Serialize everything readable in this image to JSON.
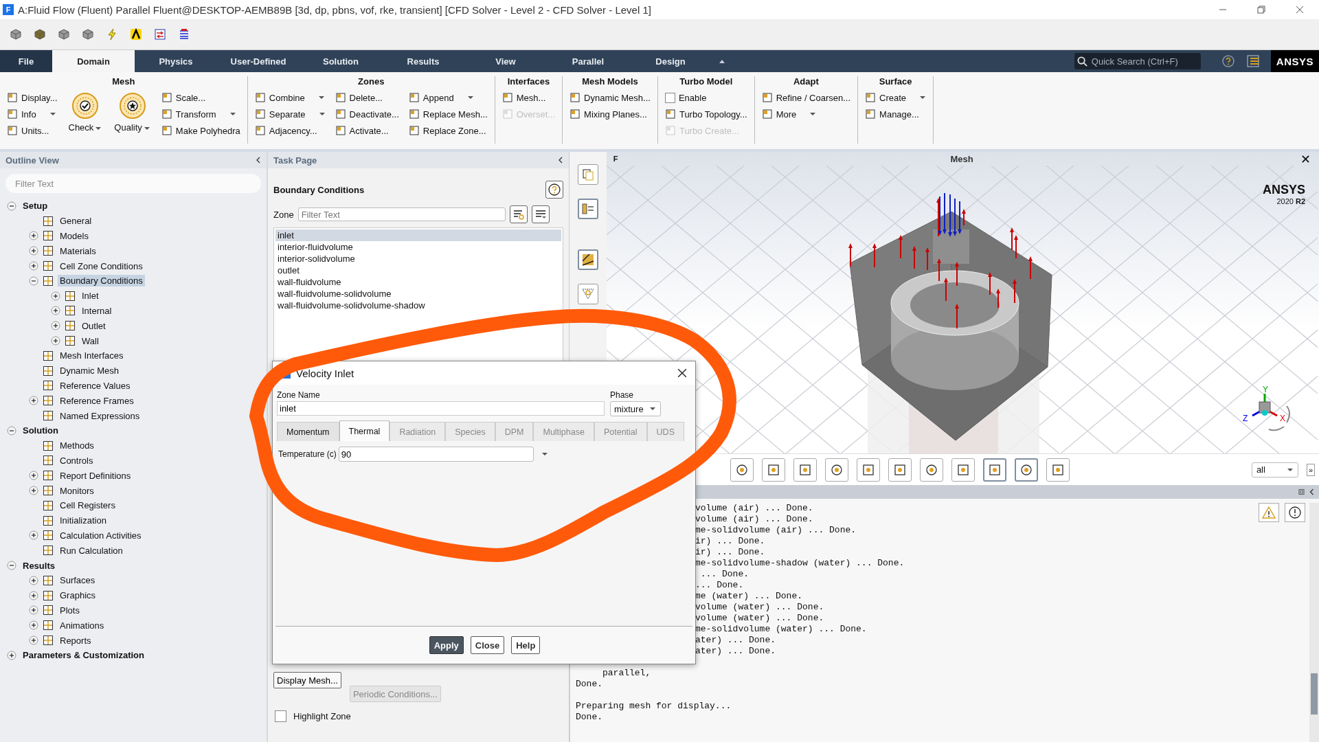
{
  "window": {
    "app_icon_letter": "F",
    "title": "A:Fluid Flow (Fluent) Parallel Fluent@DESKTOP-AEMB89B  [3d, dp, pbns, vof, rke, transient] [CFD Solver - Level 2 - CFD Solver - Level 1]"
  },
  "tabs": [
    {
      "label": "File",
      "selected": false
    },
    {
      "label": "Domain",
      "selected": true
    },
    {
      "label": "Physics",
      "selected": false
    },
    {
      "label": "User-Defined",
      "selected": false
    },
    {
      "label": "Solution",
      "selected": false
    },
    {
      "label": "Results",
      "selected": false
    },
    {
      "label": "View",
      "selected": false
    },
    {
      "label": "Parallel",
      "selected": false
    },
    {
      "label": "Design",
      "selected": false
    }
  ],
  "search": {
    "placeholder": "Quick Search (Ctrl+F)"
  },
  "logo": "ANSYS",
  "ribbon": {
    "groups": [
      {
        "title": "Mesh",
        "items": [
          {
            "kind": "small",
            "label": "Display...",
            "dropdown": false,
            "disabled": false
          },
          {
            "kind": "small",
            "label": "Info",
            "dropdown": true,
            "disabled": false
          },
          {
            "kind": "small",
            "label": "Units...",
            "dropdown": false,
            "disabled": false
          },
          {
            "kind": "big",
            "label": "Check",
            "dropdown": true
          },
          {
            "kind": "big",
            "label": "Quality",
            "dropdown": true
          },
          {
            "kind": "small",
            "label": "Scale...",
            "dropdown": false,
            "disabled": false
          },
          {
            "kind": "small",
            "label": "Transform",
            "dropdown": true,
            "disabled": false
          },
          {
            "kind": "small",
            "label": "Make Polyhedra",
            "dropdown": false,
            "disabled": false
          }
        ]
      },
      {
        "title": "Zones",
        "items": [
          {
            "kind": "small",
            "label": "Combine",
            "dropdown": true,
            "disabled": false
          },
          {
            "kind": "small",
            "label": "Separate",
            "dropdown": true,
            "disabled": false
          },
          {
            "kind": "small",
            "label": "Adjacency...",
            "dropdown": false,
            "disabled": false
          },
          {
            "kind": "small",
            "label": "Delete...",
            "dropdown": false,
            "disabled": false
          },
          {
            "kind": "small",
            "label": "Deactivate...",
            "dropdown": false,
            "disabled": false
          },
          {
            "kind": "small",
            "label": "Activate...",
            "dropdown": false,
            "disabled": false
          },
          {
            "kind": "small",
            "label": "Append",
            "dropdown": true,
            "disabled": false
          },
          {
            "kind": "small",
            "label": "Replace Mesh...",
            "dropdown": false,
            "disabled": false
          },
          {
            "kind": "small",
            "label": "Replace Zone...",
            "dropdown": false,
            "disabled": false
          }
        ]
      },
      {
        "title": "Interfaces",
        "items": [
          {
            "kind": "small",
            "label": "Mesh...",
            "dropdown": false,
            "disabled": false
          },
          {
            "kind": "small",
            "label": "Overset...",
            "dropdown": false,
            "disabled": true
          }
        ]
      },
      {
        "title": "Mesh Models",
        "items": [
          {
            "kind": "small",
            "label": "Dynamic Mesh...",
            "dropdown": false,
            "disabled": false
          },
          {
            "kind": "small",
            "label": "Mixing Planes...",
            "dropdown": false,
            "disabled": false
          }
        ]
      },
      {
        "title": "Turbo Model",
        "items": [
          {
            "kind": "checkbox",
            "label": "Enable",
            "checked": false
          },
          {
            "kind": "small",
            "label": "Turbo Topology...",
            "dropdown": false,
            "disabled": false
          },
          {
            "kind": "small",
            "label": "Turbo Create...",
            "dropdown": false,
            "disabled": true
          }
        ]
      },
      {
        "title": "Adapt",
        "items": [
          {
            "kind": "small",
            "label": "Refine / Coarsen...",
            "dropdown": false,
            "disabled": false
          },
          {
            "kind": "small",
            "label": "More",
            "dropdown": true,
            "disabled": false
          }
        ]
      },
      {
        "title": "Surface",
        "items": [
          {
            "kind": "small",
            "label": "Create",
            "dropdown": true,
            "disabled": false
          },
          {
            "kind": "small",
            "label": "Manage...",
            "dropdown": false,
            "disabled": false
          }
        ]
      }
    ]
  },
  "outline": {
    "title": "Outline View",
    "filter_placeholder": "Filter Text",
    "tree": [
      {
        "label": "Setup",
        "expanded": true,
        "selected": false,
        "children": [
          {
            "label": "General",
            "selected": false
          },
          {
            "label": "Models",
            "expanded": false,
            "selected": false
          },
          {
            "label": "Materials",
            "expanded": false,
            "selected": false
          },
          {
            "label": "Cell Zone Conditions",
            "expanded": false,
            "selected": false
          },
          {
            "label": "Boundary Conditions",
            "expanded": true,
            "selected": true,
            "children": [
              {
                "label": "Inlet",
                "expanded": false,
                "selected": false
              },
              {
                "label": "Internal",
                "expanded": false,
                "selected": false
              },
              {
                "label": "Outlet",
                "expanded": false,
                "selected": false
              },
              {
                "label": "Wall",
                "expanded": false,
                "selected": false
              }
            ]
          },
          {
            "label": "Mesh Interfaces",
            "selected": false
          },
          {
            "label": "Dynamic Mesh",
            "selected": false
          },
          {
            "label": "Reference Values",
            "selected": false
          },
          {
            "label": "Reference Frames",
            "expanded": false,
            "selected": false
          },
          {
            "label": "Named Expressions",
            "selected": false
          }
        ]
      },
      {
        "label": "Solution",
        "expanded": true,
        "selected": false,
        "children": [
          {
            "label": "Methods",
            "selected": false
          },
          {
            "label": "Controls",
            "selected": false
          },
          {
            "label": "Report Definitions",
            "expanded": false,
            "selected": false
          },
          {
            "label": "Monitors",
            "expanded": false,
            "selected": false
          },
          {
            "label": "Cell Registers",
            "selected": false
          },
          {
            "label": "Initialization",
            "selected": false
          },
          {
            "label": "Calculation Activities",
            "expanded": false,
            "selected": false
          },
          {
            "label": "Run Calculation",
            "selected": false
          }
        ]
      },
      {
        "label": "Results",
        "expanded": true,
        "selected": false,
        "children": [
          {
            "label": "Surfaces",
            "expanded": false,
            "selected": false
          },
          {
            "label": "Graphics",
            "expanded": false,
            "selected": false
          },
          {
            "label": "Plots",
            "expanded": false,
            "selected": false
          },
          {
            "label": "Animations",
            "expanded": false,
            "selected": false
          },
          {
            "label": "Reports",
            "expanded": false,
            "selected": false
          }
        ]
      },
      {
        "label": "Parameters & Customization",
        "expanded": false,
        "selected": false
      }
    ]
  },
  "task_page": {
    "title": "Task Page",
    "heading": "Boundary Conditions",
    "zone_label": "Zone",
    "zone_filter_placeholder": "Filter Text",
    "zones": [
      {
        "name": "inlet",
        "selected": true
      },
      {
        "name": "interior-fluidvolume",
        "selected": false
      },
      {
        "name": "interior-solidvolume",
        "selected": false
      },
      {
        "name": "outlet",
        "selected": false
      },
      {
        "name": "wall-fluidvolume",
        "selected": false
      },
      {
        "name": "wall-fluidvolume-solidvolume",
        "selected": false
      },
      {
        "name": "wall-fluidvolume-solidvolume-shadow",
        "selected": false
      }
    ],
    "display_mesh_button": "Display Mesh...",
    "periodic_button": {
      "label": "Periodic Conditions...",
      "disabled": true
    },
    "highlight_zone": {
      "label": "Highlight Zone",
      "checked": false
    }
  },
  "dialog": {
    "title": "Velocity Inlet",
    "zone_name_label": "Zone Name",
    "zone_name": "inlet",
    "phase_label": "Phase",
    "phase": "mixture",
    "tabs": [
      {
        "label": "Momentum",
        "selected": false,
        "disabled": false
      },
      {
        "label": "Thermal",
        "selected": true,
        "disabled": false
      },
      {
        "label": "Radiation",
        "selected": false,
        "disabled": true
      },
      {
        "label": "Species",
        "selected": false,
        "disabled": true
      },
      {
        "label": "DPM",
        "selected": false,
        "disabled": true
      },
      {
        "label": "Multiphase",
        "selected": false,
        "disabled": true
      },
      {
        "label": "Potential",
        "selected": false,
        "disabled": true
      },
      {
        "label": "UDS",
        "selected": false,
        "disabled": true
      }
    ],
    "temperature_label": "Temperature (c)",
    "temperature": "90",
    "buttons": [
      {
        "label": "Apply",
        "primary": true
      },
      {
        "label": "Close",
        "primary": false
      },
      {
        "label": "Help",
        "primary": false
      }
    ]
  },
  "graphics": {
    "app_icon_letter": "F",
    "title": "Mesh",
    "brand": "ANSYS",
    "version": "2020 **R2**",
    "axis_labels": [
      "X",
      "Y",
      "Z"
    ],
    "display_filter": "all",
    "more_button": "»"
  },
  "console": {
    "clipped_lines": [
      "volume (air) ... Done.",
      "volume (air) ... Done.",
      "me-solidvolume (air) ... Done.",
      "ir) ... Done.",
      "ir) ... Done.",
      "me-solidvolume-shadow (water) ... Done.",
      " ... Done.",
      "... Done.",
      "me (water) ... Done.",
      "volume (water) ... Done.",
      "volume (water) ... Done.",
      "me-solidvolume (water) ... Done.",
      "ater) ... Done.",
      "ater) ... Done."
    ],
    "blocks": [
      [
        "     parallel,",
        "Done."
      ],
      [
        "Preparing mesh for display...",
        "Done."
      ]
    ]
  }
}
